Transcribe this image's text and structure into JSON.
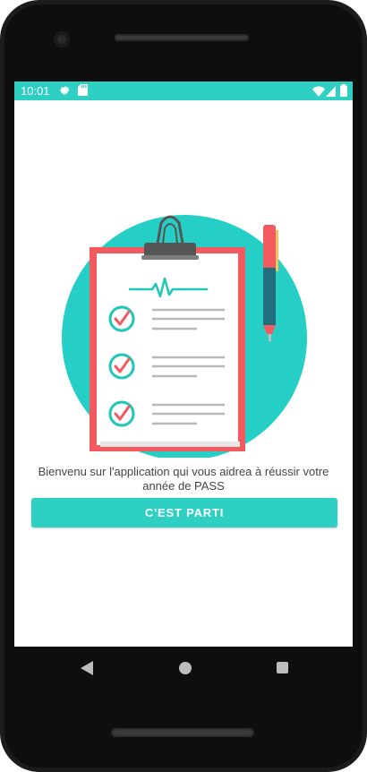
{
  "status_bar": {
    "time": "10:01",
    "color": "#2ed0c4"
  },
  "icons": [
    "settings-icon",
    "sd-card-icon",
    "wifi-icon",
    "cell-signal-icon",
    "battery-icon",
    "clipboard-illustration",
    "pen-illustration",
    "back-icon",
    "home-icon",
    "recents-icon"
  ],
  "welcome": {
    "text": "Bienvenu sur l'application qui vous aidrea à réussir votre année de PASS"
  },
  "start_button": {
    "label": "C'EST PARTI"
  },
  "colors": {
    "accent": "#2ed0c4",
    "clipboard_border": "#f25a5f",
    "check": "#1ec7b8"
  }
}
